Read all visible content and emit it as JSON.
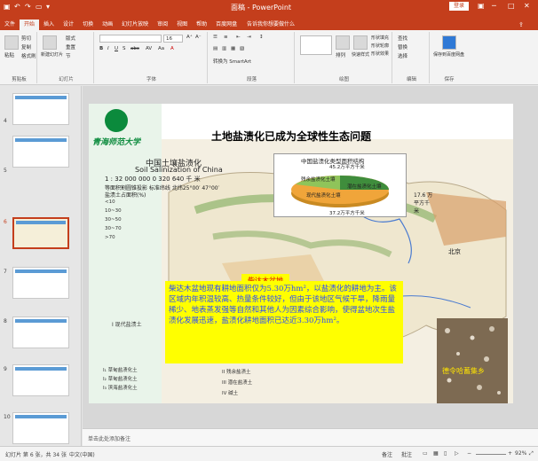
{
  "titlebar": {
    "doc_title": "面稿 - PowerPoint",
    "login": "登录",
    "tell_me": "告诉我你想要做什么",
    "tabs": [
      "文件",
      "开始",
      "插入",
      "设计",
      "切换",
      "动画",
      "幻灯片放映",
      "审阅",
      "视图",
      "帮助",
      "百度网盘"
    ]
  },
  "ribbon": {
    "paste": "粘贴",
    "cut": "剪切",
    "copy": "复制",
    "format_painter": "格式刷",
    "new_slide": "新建幻灯片",
    "layout": "版式",
    "reset": "重置",
    "section": "节",
    "font_size": "16",
    "convert_smartart": "转换为 SmartArt",
    "find": "查找",
    "replace": "替换",
    "select": "选择",
    "shape_fill": "形状填充",
    "shape_outline": "形状轮廓",
    "shape_effect": "形状效果",
    "quick_styles": "快速样式",
    "arrange": "排列",
    "save_baidu": "保存到百度网盘",
    "groups": [
      "剪贴板",
      "幻灯片",
      "字体",
      "段落",
      "绘图",
      "编辑",
      "保存"
    ]
  },
  "thumbs": [
    "4",
    "5",
    "6",
    "7",
    "8",
    "9",
    "10"
  ],
  "notes_placeholder": "单击此处添加备注",
  "status": {
    "slide_info": "幻灯片 第 6 张，共 34 张",
    "language": "中文(中国)",
    "notes_btn": "备注",
    "comments_btn": "批注",
    "zoom": "92%"
  },
  "slide": {
    "title": "土地盐渍化已成为全球性生态问题",
    "logo_text": "青海师范大学",
    "map_title_cn": "中国土壤盐渍化",
    "map_title_en": "Soil Salinization of China",
    "scale": "1 : 32 000 000  0    320    640 千 米",
    "scale2": "等面积割圆锥投影  标准纬线  北纬25°00′  47°00′",
    "legend_title": "盐渍土占面积(%)",
    "legend_items": [
      "<10",
      "10~30",
      "30~50",
      "30~70",
      ">70"
    ],
    "pie": {
      "title": "中国盐渍化类型面积结构",
      "top_value": "45.2万平方千米",
      "label_a": "残余盐渍化土壤",
      "label_b": "潜在盐渍化土壤",
      "label_c": "现代盐渍化土壤",
      "side_value": "17.6 万平方千米",
      "bottom_value": "37.2万平方千米"
    },
    "salt_label": "柴达木盆地",
    "beijing": "北京",
    "yellow_text": "柴达木盆地现有耕地面积仅为5.30万hm²，以盐渍化的耕地为主。该区域内年积温较高、热量条件较好，但由于该地区气候干旱，降雨量稀少、地表蒸发强等自然和其他人为因素综合影响，使得盆地次生盐渍化发展迅速，盐渍化耕地面积已达近3.30万hm²。",
    "photo_caption": "德令哈蓄集乡",
    "big_legend_title": "I  现代盐渍土",
    "big_legend_rows": [
      "I₁ 草甸盐渍化土",
      "I₂ 草甸盐渍化土",
      "I₃ 滨海盐渍化土",
      "II  残余盐渍土",
      "III 潜在盐渍土",
      "IV 碱土"
    ]
  },
  "colors": {
    "ppt_red": "#c43e1c",
    "highlight_yellow": "#ffff00",
    "text_blue": "#2a4bff"
  }
}
